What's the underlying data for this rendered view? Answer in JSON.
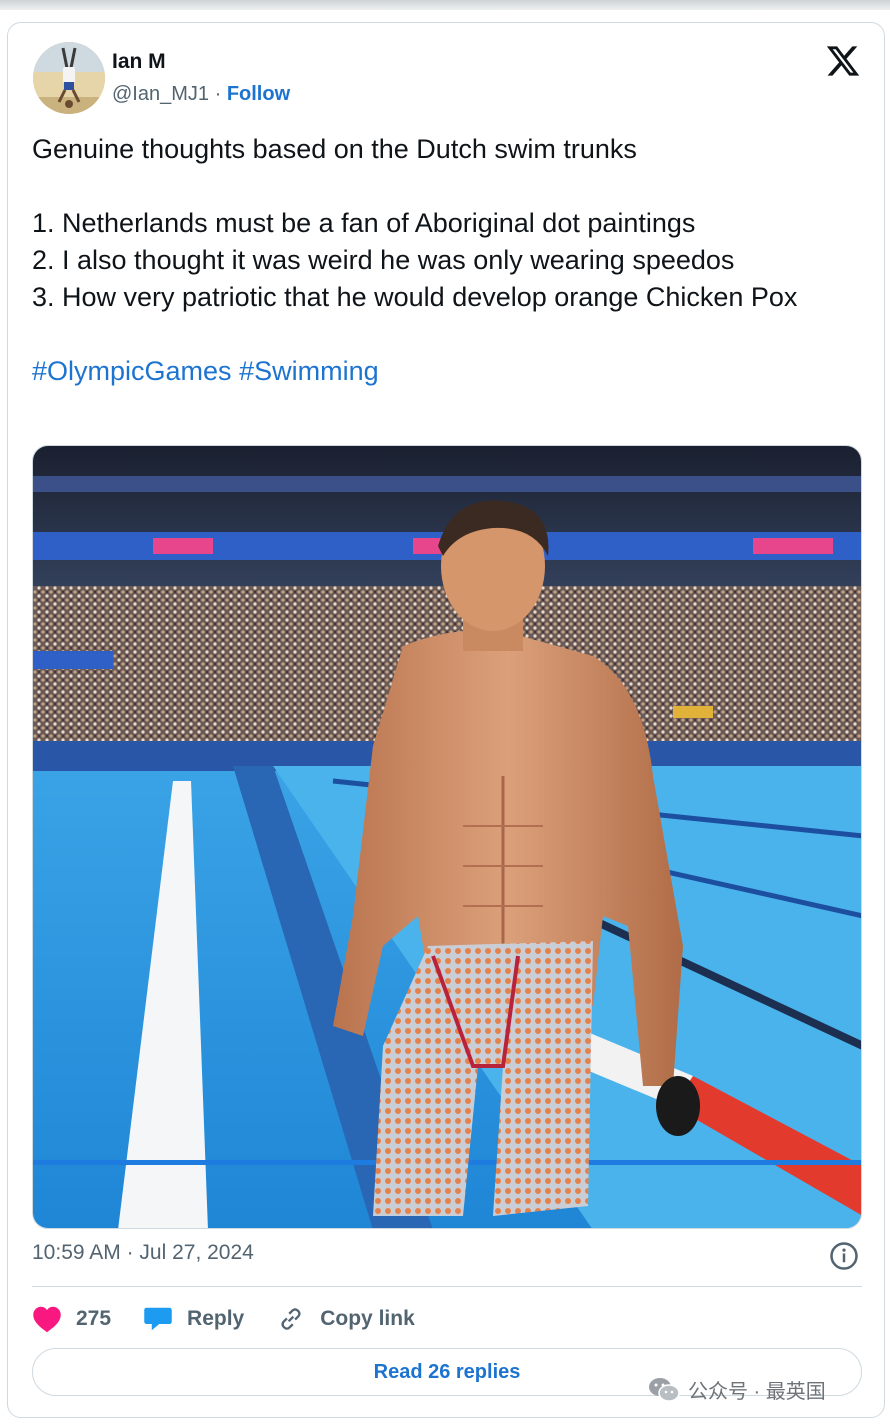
{
  "author": {
    "name": "Ian M",
    "handle": "@Ian_MJ1",
    "separator": "·",
    "follow_label": "Follow"
  },
  "tweet": {
    "line1": "Genuine thoughts based on the Dutch swim trunks",
    "item1": "1. Netherlands must be a fan of Aboriginal dot paintings",
    "item2": "2. I also thought it was weird he was only wearing speedos",
    "item3": "3. How very patriotic that he would develop orange Chicken Pox",
    "hashtag1": "#OlympicGames",
    "hashtag2": "#Swimming"
  },
  "meta": {
    "time": "10:59 AM",
    "separator": "·",
    "date": "Jul 27, 2024"
  },
  "actions": {
    "likes_count": "275",
    "reply_label": "Reply",
    "copy_label": "Copy link"
  },
  "read_replies_label": "Read 26 replies",
  "watermark": "公众号 · 最英国",
  "icons": {
    "platform": "x-logo-icon",
    "info": "info-icon",
    "like": "heart-icon",
    "reply": "speech-bubble-icon",
    "copy": "link-icon",
    "watermark": "wechat-icon"
  },
  "colors": {
    "accent": "#1d74d0",
    "like": "#f91880",
    "reply": "#1d9bf0",
    "muted": "#536471",
    "border": "#cfd9de"
  }
}
